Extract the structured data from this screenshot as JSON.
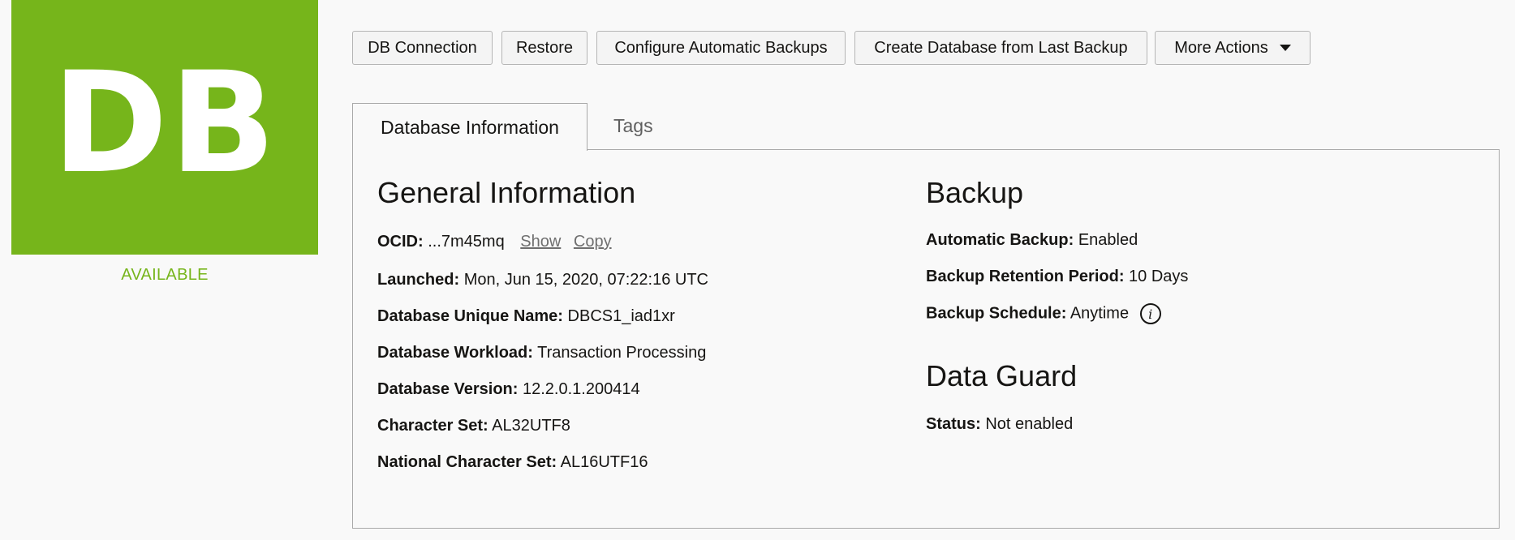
{
  "badge": {
    "text": "DB",
    "state": "AVAILABLE"
  },
  "toolbar": {
    "db_connection": "DB Connection",
    "restore": "Restore",
    "configure_backups": "Configure Automatic Backups",
    "create_from_backup": "Create Database from Last Backup",
    "more_actions": "More Actions"
  },
  "tabs": {
    "info": "Database Information",
    "tags": "Tags"
  },
  "general": {
    "heading": "General Information",
    "ocid_label": "OCID:",
    "ocid_value": "...7m45mq",
    "show": "Show",
    "copy": "Copy",
    "launched_label": "Launched:",
    "launched_value": "Mon, Jun 15, 2020, 07:22:16 UTC",
    "unique_name_label": "Database Unique Name:",
    "unique_name_value": "DBCS1_iad1xr",
    "workload_label": "Database Workload:",
    "workload_value": "Transaction Processing",
    "version_label": "Database Version:",
    "version_value": "12.2.0.1.200414",
    "charset_label": "Character Set:",
    "charset_value": "AL32UTF8",
    "ncharset_label": "National Character Set:",
    "ncharset_value": "AL16UTF16"
  },
  "backup": {
    "heading": "Backup",
    "auto_label": "Automatic Backup:",
    "auto_value": "Enabled",
    "retention_label": "Backup Retention Period:",
    "retention_value": "10 Days",
    "schedule_label": "Backup Schedule:",
    "schedule_value": "Anytime",
    "info_icon_glyph": "i"
  },
  "dataguard": {
    "heading": "Data Guard",
    "status_label": "Status:",
    "status_value": "Not enabled"
  },
  "colors": {
    "badge_green": "#76b51b",
    "link_gray": "#6f6f6f",
    "border": "#a9a9a9"
  }
}
